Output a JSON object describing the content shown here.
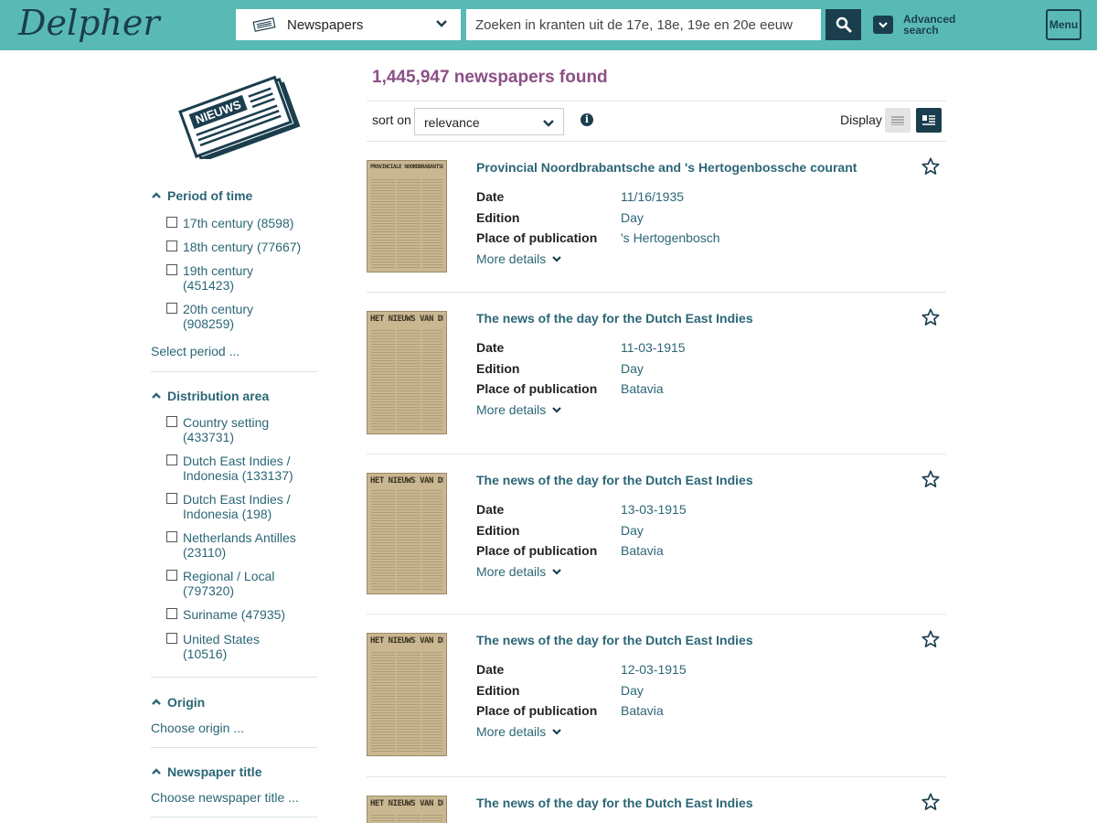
{
  "header": {
    "logo": "Delpher",
    "collection_label": "Newspapers",
    "search_placeholder": "Zoeken in kranten uit de 17e, 18e, 19e en 20e eeuw",
    "advanced_search": "Advanced search",
    "menu": "Menu",
    "colors": {
      "bar": "#59bab5",
      "dark": "#1b3e4e"
    }
  },
  "sidebar": {
    "illustration_text": "NIEUWS",
    "facets": [
      {
        "title": "Period of time",
        "options": [
          "17th century (8598)",
          "18th century (77667)",
          "19th century (451423)",
          "20th century (908259)"
        ],
        "link": "Select period ..."
      },
      {
        "title": "Distribution area",
        "options": [
          "Country setting (433731)",
          "Dutch East Indies / Indonesia (133137)",
          "Dutch East Indies / Indonesia (198)",
          "Netherlands Antilles (23110)",
          "Regional / Local (797320)",
          "Suriname (47935)",
          "United States (10516)"
        ]
      },
      {
        "title": "Origin",
        "link": "Choose origin ..."
      },
      {
        "title": "Newspaper title",
        "link": "Choose newspaper title ..."
      }
    ]
  },
  "main": {
    "results_count": "1,445,947 newspapers found",
    "sort_label": "sort on",
    "sort_value": "relevance",
    "display_label": "Display",
    "results": [
      {
        "title": "Provincial Noordbrabantsche and 's Hertogenbossche courant",
        "masthead": "PROVINCIALE NOORDBRABANTSCHE",
        "date": "11/16/1935",
        "edition": "Day",
        "place": "'s Hertogenbosch"
      },
      {
        "title": "The news of the day for the Dutch East Indies",
        "masthead": "HET NIEUWS VAN DEN DAG",
        "date": "11-03-1915",
        "edition": "Day",
        "place": "Batavia"
      },
      {
        "title": "The news of the day for the Dutch East Indies",
        "masthead": "HET NIEUWS VAN DEN DAG",
        "date": "13-03-1915",
        "edition": "Day",
        "place": "Batavia"
      },
      {
        "title": "The news of the day for the Dutch East Indies",
        "masthead": "HET NIEUWS VAN DEN DAG",
        "date": "12-03-1915",
        "edition": "Day",
        "place": "Batavia"
      },
      {
        "title": "The news of the day for the Dutch East Indies",
        "masthead": "HET NIEUWS VAN DEN DAG"
      }
    ],
    "field_labels": {
      "date": "Date",
      "edition": "Edition",
      "place": "Place of publication"
    },
    "more_details": "More details"
  }
}
